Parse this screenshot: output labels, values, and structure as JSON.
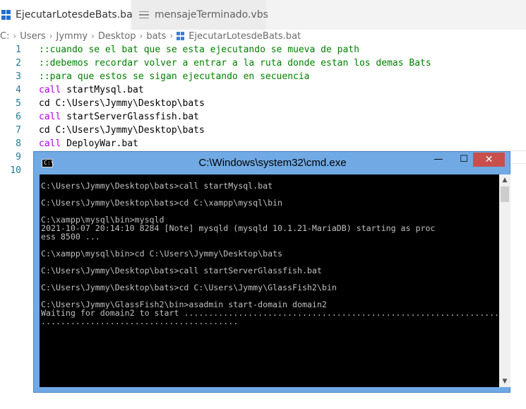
{
  "tabs": [
    {
      "label": "EjecutarLotesdeBats.bat",
      "icon": "windows-bat-icon",
      "active": true,
      "close": "×"
    },
    {
      "label": "mensajeTerminado.vbs",
      "icon": "file-lines-icon",
      "active": false,
      "modified": true
    }
  ],
  "breadcrumb": {
    "parts": [
      "C:",
      "Users",
      "Jymmy",
      "Desktop",
      "bats",
      "EjecutarLotesdeBats.bat"
    ],
    "separator": "›"
  },
  "editor": {
    "lines": [
      {
        "num": "1",
        "a": "",
        "b": "::cuando se el bat que se esta ejecutando se mueva de path"
      },
      {
        "num": "2",
        "a": "",
        "b": "::debemos recordar volver a entrar a la ruta donde estan los demas Bats"
      },
      {
        "num": "3",
        "a": "",
        "b": "::para que estos se sigan ejecutando en secuencia"
      },
      {
        "num": "4",
        "a": "call",
        "b": " startMysql.bat"
      },
      {
        "num": "5",
        "a": "",
        "b": "cd C:\\Users\\Jymmy\\Desktop\\bats"
      },
      {
        "num": "6",
        "a": "call",
        "b": " startServerGlassfish.bat"
      },
      {
        "num": "7",
        "a": "",
        "b": "cd C:\\Users\\Jymmy\\Desktop\\bats"
      },
      {
        "num": "8",
        "a": "call",
        "b": " DeployWar.bat"
      },
      {
        "num": "9",
        "a": "",
        "b": ""
      },
      {
        "num": "10",
        "a": "",
        "b": ""
      }
    ]
  },
  "cmd": {
    "icon_text": "C:\\",
    "title": "C:\\Windows\\system32\\cmd.exe",
    "buttons": {
      "minimize": "—",
      "maximize": "☐",
      "close": "✕"
    },
    "scroll": {
      "up": "▲",
      "down": "▼"
    },
    "output": "C:\\Users\\Jymmy\\Desktop\\bats>call startMysql.bat\n\nC:\\Users\\Jymmy\\Desktop\\bats>cd C:\\xampp\\mysql\\bin\n\nC:\\xampp\\mysql\\bin>mysqld\n2021-10-07 20:14:10 8284 [Note] mysqld (mysqld 10.1.21-MariaDB) starting as proc\ness 8500 ...\n\nC:\\xampp\\mysql\\bin>cd C:\\Users\\Jymmy\\Desktop\\bats\n\nC:\\Users\\Jymmy\\Desktop\\bats>call startServerGlassfish.bat\n\nC:\\Users\\Jymmy\\Desktop\\bats>cd C:\\Users\\Jymmy\\GlassFish2\\bin\n\nC:\\Users\\Jymmy\\GlassFish2\\bin>asadmin start-domain domain2\nWaiting for domain2 to start ...............................................................................\n........................................"
  },
  "colors": {
    "comment": "#008000",
    "keyword": "#af00db",
    "line_number": "#237893",
    "console_bg": "#000000",
    "console_text": "#c0c0c0",
    "window_frame": "#70a9e4",
    "close_button": "#c7504d"
  }
}
